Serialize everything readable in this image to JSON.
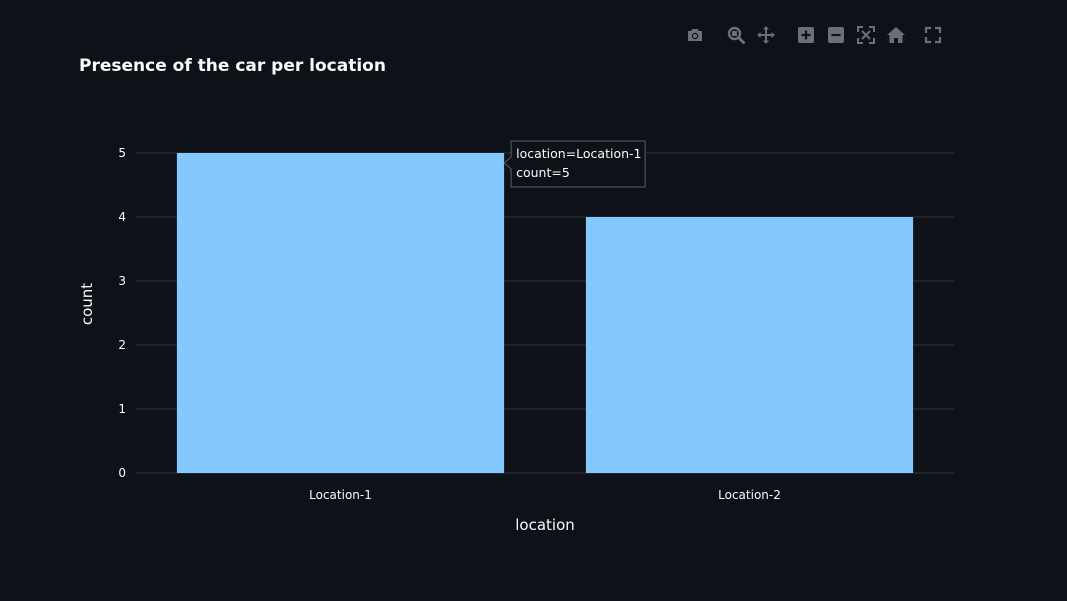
{
  "modebar": {
    "buttons": [
      {
        "name": "camera-icon"
      },
      {
        "name": "zoom-icon"
      },
      {
        "name": "pan-icon"
      },
      {
        "name": "zoom-in-icon"
      },
      {
        "name": "zoom-out-icon"
      },
      {
        "name": "autoscale-icon"
      },
      {
        "name": "reset-axes-icon"
      },
      {
        "name": "fullscreen-icon"
      }
    ],
    "color": "#6b6f78"
  },
  "chart_data": {
    "type": "bar",
    "title": "Presence of the car per location",
    "xlabel": "location",
    "ylabel": "count",
    "categories": [
      "Location-1",
      "Location-2"
    ],
    "values": [
      5,
      4
    ],
    "ylim": [
      0,
      5
    ],
    "yticks": [
      "0",
      "1",
      "2",
      "3",
      "4",
      "5"
    ],
    "grid": true,
    "bar_color": "#83c9ff",
    "gridline_color": "#31333f",
    "tooltip": {
      "category_index": 0,
      "lines": [
        "location=Location-1",
        "count=5"
      ]
    }
  }
}
